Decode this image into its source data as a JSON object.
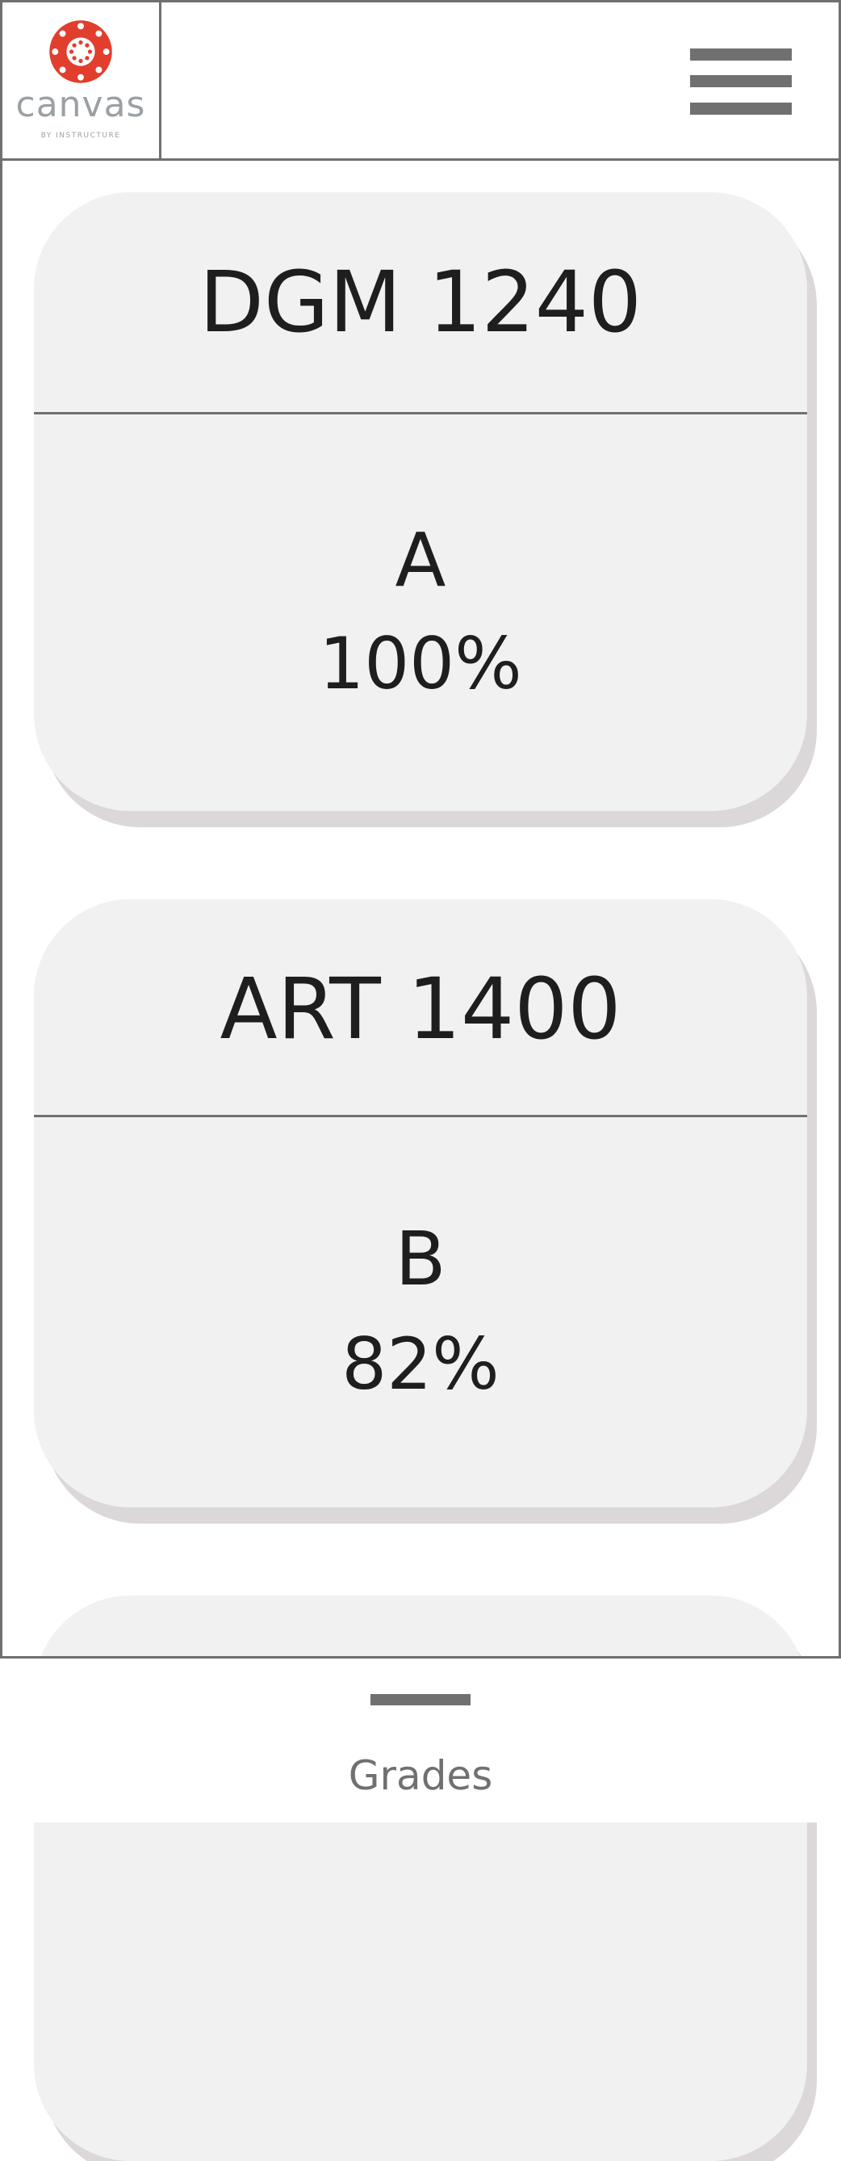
{
  "header": {
    "logo": {
      "wordmark": "canvas",
      "tagline": "BY INSTRUCTURE",
      "brand_color": "#e13e2d"
    },
    "menu_icon": "hamburger-menu-icon"
  },
  "courses": [
    {
      "code": "DGM 1240",
      "letter_grade": "A",
      "percent": "100%"
    },
    {
      "code": "ART 1400",
      "letter_grade": "B",
      "percent": "82%"
    },
    {
      "code": "",
      "letter_grade": "",
      "percent": ""
    }
  ],
  "bottom_nav": {
    "active_tab": {
      "label": "Grades"
    }
  },
  "colors": {
    "card_background": "#f1f1f1",
    "card_shadow": "#dcd7d9",
    "divider": "#707070",
    "text": "#1e1e1e"
  }
}
